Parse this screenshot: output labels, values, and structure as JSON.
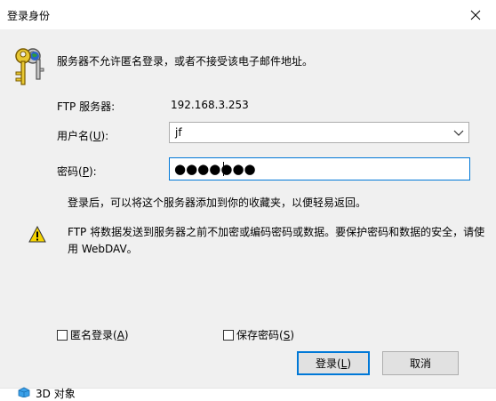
{
  "window": {
    "title": "登录身份"
  },
  "header": {
    "message": "服务器不允许匿名登录，或者不接受该电子邮件地址。"
  },
  "form": {
    "server_label": "FTP 服务器:",
    "server_value": "192.168.3.253",
    "username_label": "用户名",
    "username_access": "U",
    "username_value": "jf",
    "password_label": "密码",
    "password_access": "P",
    "password_mask": "●●●●●●●"
  },
  "info": {
    "message": "登录后，可以将这个服务器添加到你的收藏夹，以便轻易返回。"
  },
  "warning": {
    "message": "FTP 将数据发送到服务器之前不加密或编码密码或数据。要保护密码和数据的安全，请使用 WebDAV。"
  },
  "options": {
    "anonymous_label": "匿名登录",
    "anonymous_access": "A",
    "anonymous_checked": false,
    "save_password_label": "保存密码",
    "save_password_access": "S",
    "save_password_checked": false
  },
  "buttons": {
    "login_label": "登录",
    "login_access": "L",
    "cancel_label": "取消"
  },
  "background": {
    "item_label": "3D 对象"
  },
  "colors": {
    "accent": "#0078d7",
    "dialog_bg": "#f0f0f0",
    "warning": "#f5d300"
  },
  "icons": [
    "keys-icon",
    "close-icon",
    "chevron-down-icon",
    "warning-icon",
    "folder-3d-icon"
  ]
}
